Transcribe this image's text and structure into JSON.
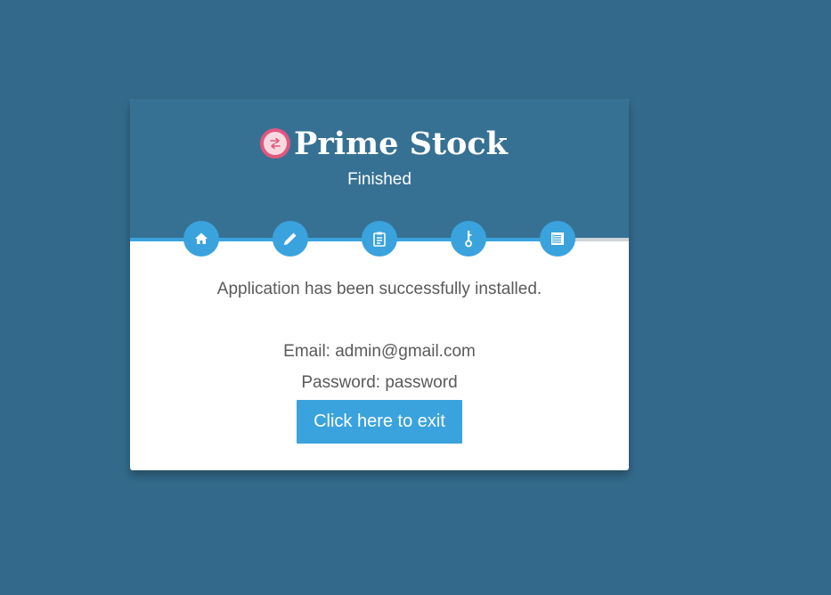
{
  "app": {
    "brand_name": "Prime Stock",
    "step_title": "Finished"
  },
  "steps": [
    {
      "icon": "home-icon"
    },
    {
      "icon": "pencil-icon"
    },
    {
      "icon": "clipboard-icon"
    },
    {
      "icon": "key-icon"
    },
    {
      "icon": "list-icon"
    }
  ],
  "content": {
    "success_message": "Application has been successfully installed.",
    "email_line": "Email: admin@gmail.com",
    "password_line": "Password: password",
    "exit_label": "Click here to exit"
  },
  "colors": {
    "background": "#336a8b",
    "header": "#367194",
    "accent": "#3aa3dd",
    "logo": "#e2577f",
    "text": "#5a5a5a"
  }
}
